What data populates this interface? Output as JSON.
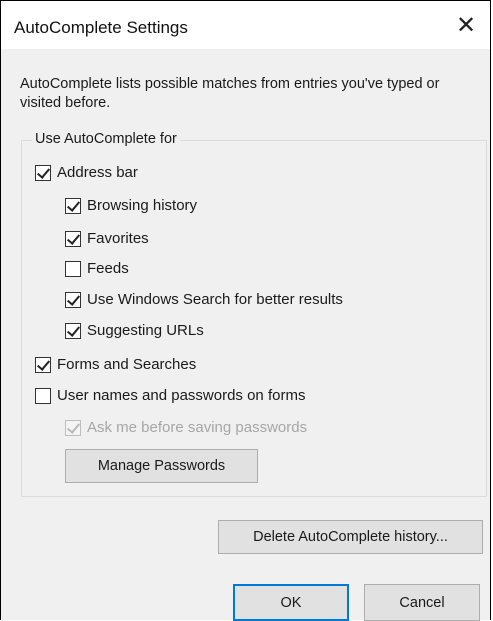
{
  "dialog": {
    "title": "AutoComplete Settings",
    "close_glyph": "✕",
    "description": "AutoComplete lists possible matches from entries you've typed or visited before."
  },
  "group": {
    "label": "Use AutoComplete for",
    "items": [
      {
        "label": "Address bar",
        "checked": true,
        "enabled": true
      },
      {
        "label": "Browsing history",
        "checked": true,
        "enabled": true
      },
      {
        "label": "Favorites",
        "checked": true,
        "enabled": true
      },
      {
        "label": "Feeds",
        "checked": false,
        "enabled": true
      },
      {
        "label": "Use Windows Search for better results",
        "checked": true,
        "enabled": true
      },
      {
        "label": "Suggesting URLs",
        "checked": true,
        "enabled": true
      },
      {
        "label": "Forms and Searches",
        "checked": true,
        "enabled": true
      },
      {
        "label": "User names and passwords on forms",
        "checked": false,
        "enabled": true
      },
      {
        "label": "Ask me before saving passwords",
        "checked": true,
        "enabled": false
      }
    ],
    "manage_passwords_label": "Manage Passwords"
  },
  "buttons": {
    "delete_history": "Delete AutoComplete history...",
    "ok": "OK",
    "cancel": "Cancel"
  },
  "colors": {
    "accent": "#0078d7",
    "dialog_bg": "#f0f0f0"
  }
}
